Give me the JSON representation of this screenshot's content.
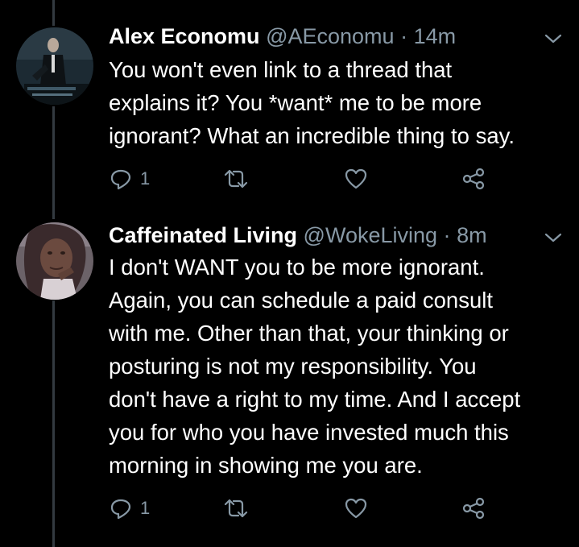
{
  "colors": {
    "background": "#000000",
    "text": "#ffffff",
    "secondary": "#8899a6",
    "thread_line": "#333a40"
  },
  "tweets": [
    {
      "name": "Alex Economu",
      "handle": "@AEconomu",
      "separator": "·",
      "time": "14m",
      "lines": [
        "You won't even link to a thread that",
        "explains it?  You *want* me to be more",
        "ignorant?  What an incredible thing to say."
      ],
      "reply_count": "1",
      "icons": [
        "reply-icon",
        "retweet-icon",
        "like-icon",
        "share-icon",
        "chevron-down-icon"
      ]
    },
    {
      "name": "Caffeinated Living",
      "handle": "@WokeLiving",
      "separator": "·",
      "time": "8m",
      "lines": [
        "I don't WANT you to be more ignorant.",
        "Again, you can schedule a paid consult",
        "with me. Other than that, your thinking or",
        "posturing is not my responsibility. You",
        "don't have a right to my time. And I accept",
        "you for who you have invested much this",
        "morning in showing me you are."
      ],
      "reply_count": "1",
      "icons": [
        "reply-icon",
        "retweet-icon",
        "like-icon",
        "share-icon",
        "chevron-down-icon"
      ]
    }
  ]
}
